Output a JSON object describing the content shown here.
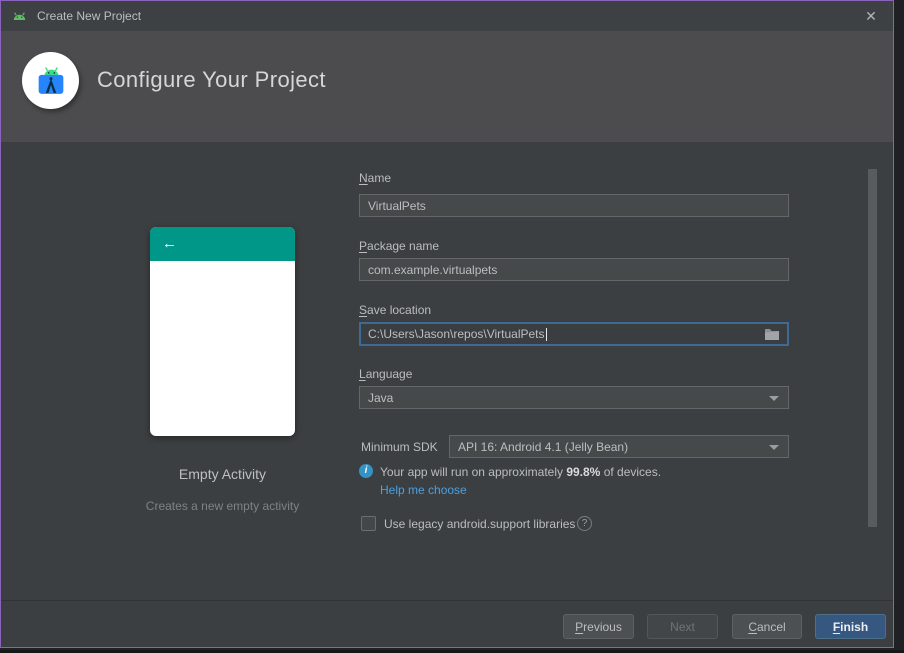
{
  "window": {
    "title": "Create New Project",
    "close_glyph": "✕"
  },
  "header": {
    "title": "Configure Your Project"
  },
  "preview": {
    "back_glyph": "←",
    "name": "Empty Activity",
    "description": "Creates a new empty activity"
  },
  "form": {
    "name_label_first": "N",
    "name_label_rest": "ame",
    "name_value": "VirtualPets",
    "package_label_first": "P",
    "package_label_rest": "ackage name",
    "package_value": "com.example.virtualpets",
    "location_label_first": "S",
    "location_label_rest": "ave location",
    "location_value": "C:\\Users\\Jason\\repos\\VirtualPets",
    "language_label_first": "L",
    "language_label_rest": "anguage",
    "language_value": "Java",
    "minsdk_label": "Minimum SDK",
    "minsdk_value": "API 16: Android 4.1 (Jelly Bean)",
    "sdk_note_prefix": "Your app will run on approximately ",
    "sdk_note_bold": "99.8%",
    "sdk_note_suffix": " of devices.",
    "info_glyph": "i",
    "help_link": "Help me choose",
    "legacy_label": "Use legacy android.support libraries",
    "legacy_checked": false,
    "help_glyph": "?"
  },
  "buttons": {
    "previous_first": "P",
    "previous_rest": "revious",
    "next": "Next",
    "cancel_first": "C",
    "cancel_rest": "ancel",
    "finish_first": "F",
    "finish_rest": "inish"
  },
  "colors": {
    "window_border": "#8b63bd",
    "accent_teal": "#009688",
    "focus_blue": "#3f6a94",
    "link_blue": "#4c9fe0",
    "primary_button": "#365880",
    "android_green": "#3ddc84"
  }
}
